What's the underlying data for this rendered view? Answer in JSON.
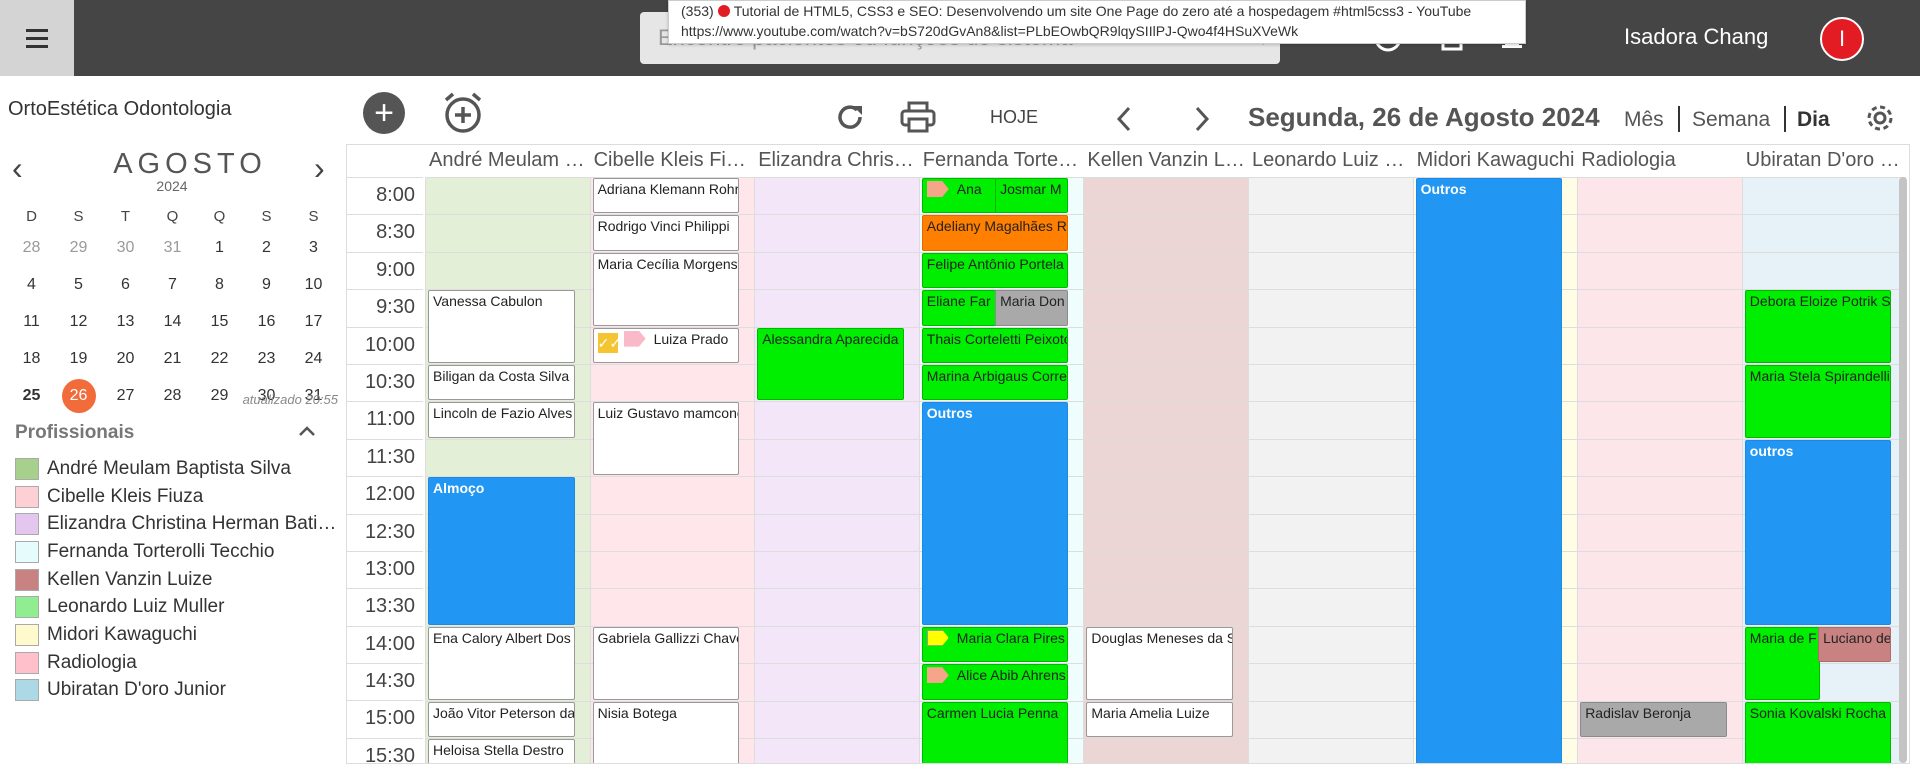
{
  "header": {
    "search_placeholder": "Encontre pacientes ou funções do sistema",
    "user_name": "Isadora Chang",
    "avatar_letter": "I"
  },
  "tooltip": {
    "line1_prefix": "(353)",
    "line1_title": "Tutorial de HTML5, CSS3 e SEO: Desenvolvendo um site One Page do zero até a hospedagem #html5css3 - YouTube",
    "line2": "https://www.youtube.com/watch?v=bS720dGvAn8&list=PLbEOwbQR9lqySIIlPJ-Qwo4f4HSuXVeWk"
  },
  "sidebar": {
    "clinic_name": "OrtoEstética Odontologia",
    "calendar": {
      "month": "AGOSTO",
      "year": "2024",
      "dow": [
        "D",
        "S",
        "T",
        "Q",
        "Q",
        "S",
        "S"
      ],
      "weeks": [
        [
          "28",
          "29",
          "30",
          "31",
          "1",
          "2",
          "3"
        ],
        [
          "4",
          "5",
          "6",
          "7",
          "8",
          "9",
          "10"
        ],
        [
          "11",
          "12",
          "13",
          "14",
          "15",
          "16",
          "17"
        ],
        [
          "18",
          "19",
          "20",
          "21",
          "22",
          "23",
          "24"
        ],
        [
          "25",
          "26",
          "27",
          "28",
          "29",
          "30",
          "31"
        ]
      ],
      "selected": "26",
      "updated": "atualizado 20:55"
    },
    "professionals_title": "Profissionais",
    "professionals": [
      {
        "name": "André Meulam Baptista Silva",
        "color": "#a8d08d"
      },
      {
        "name": "Cibelle Kleis Fiuza",
        "color": "#ffcfd6"
      },
      {
        "name": "Elizandra Christina Herman Batista",
        "color": "#e3c7ef"
      },
      {
        "name": "Fernanda Torterolli Tecchio",
        "color": "#e6fbfb"
      },
      {
        "name": "Kellen Vanzin Luize",
        "color": "#c98282"
      },
      {
        "name": "Leonardo Luiz Muller",
        "color": "#90ee90"
      },
      {
        "name": "Midori Kawaguchi",
        "color": "#fffacd"
      },
      {
        "name": "Radiologia",
        "color": "#ffc0cb"
      },
      {
        "name": "Ubiratan D'oro Junior",
        "color": "#add8e6"
      }
    ]
  },
  "toolbar": {
    "today": "HOJE",
    "date_title": "Segunda, 26 de Agosto 2024",
    "view_month": "Mês",
    "view_week": "Semana",
    "view_day": "Dia"
  },
  "schedule": {
    "times": [
      "8:00",
      "8:30",
      "9:00",
      "9:30",
      "10:00",
      "10:30",
      "11:00",
      "11:30",
      "12:00",
      "12:30",
      "13:00",
      "13:30",
      "14:00",
      "14:30",
      "15:00",
      "15:30"
    ],
    "columns": [
      {
        "name": "André Meulam Baptista Silva",
        "bg": "#e3efd6"
      },
      {
        "name": "Cibelle Kleis Fiuza",
        "bg": "#ffe6ea"
      },
      {
        "name": "Elizandra Christina Herman Batista",
        "bg": "#f3e6f8"
      },
      {
        "name": "Fernanda Torterolli Tecchio",
        "bg": "#f0fdfd"
      },
      {
        "name": "Kellen Vanzin Luize",
        "bg": "#ebd5d5"
      },
      {
        "name": "Leonardo Luiz Muller",
        "bg": "#f2f2f2"
      },
      {
        "name": "Midori Kawaguchi",
        "bg": "#fffde6"
      },
      {
        "name": "Radiologia",
        "bg": "#fde6ea"
      },
      {
        "name": "Ubiratan D'oro Junior",
        "bg": "#e6f2f7"
      }
    ],
    "events": [
      {
        "col": 0,
        "start": 3,
        "span": 2,
        "style": "white",
        "text": "Vanessa Cabulon"
      },
      {
        "col": 0,
        "start": 5,
        "span": 1,
        "style": "white",
        "text": "Biligan da Costa Silva"
      },
      {
        "col": 0,
        "start": 6,
        "span": 1,
        "style": "white",
        "text": "Lincoln de Fazio Alves"
      },
      {
        "col": 0,
        "start": 8,
        "span": 4,
        "style": "blue",
        "text": "Almoço"
      },
      {
        "col": 0,
        "start": 12,
        "span": 2,
        "style": "white",
        "text": "Ena Calory Albert Dos Santos"
      },
      {
        "col": 0,
        "start": 14,
        "span": 1,
        "style": "white",
        "text": "João Vitor Peterson da Silva"
      },
      {
        "col": 0,
        "start": 15,
        "span": 1,
        "style": "white",
        "text": "Heloisa Stella Destro"
      },
      {
        "col": 1,
        "start": 0,
        "span": 1,
        "style": "white",
        "text": "Adriana Klemann Rohr"
      },
      {
        "col": 1,
        "start": 1,
        "span": 1,
        "style": "white",
        "text": "Rodrigo Vinci Philippi"
      },
      {
        "col": 1,
        "start": 2,
        "span": 2,
        "style": "white",
        "text": "Maria Cecília Morgenstern"
      },
      {
        "col": 1,
        "start": 4,
        "span": 1,
        "style": "white",
        "text": "Luiza Prado",
        "check": true,
        "tag": "pink"
      },
      {
        "col": 1,
        "start": 6,
        "span": 2,
        "style": "white",
        "text": "Luiz Gustavo mamcono"
      },
      {
        "col": 1,
        "start": 12,
        "span": 2,
        "style": "white",
        "text": "Gabriela Gallizzi Chaves"
      },
      {
        "col": 1,
        "start": 14,
        "span": 2,
        "style": "white",
        "text": "Nisia Botega"
      },
      {
        "col": 2,
        "start": 4,
        "span": 2,
        "style": "green",
        "text": "Alessandra Aparecida"
      },
      {
        "col": 3,
        "start": 0,
        "span": 1,
        "style": "green",
        "text": "Ana",
        "tag": "salmon",
        "half": "left"
      },
      {
        "col": 3,
        "start": 0,
        "span": 1,
        "style": "green",
        "text": "Josmar M",
        "half": "right"
      },
      {
        "col": 3,
        "start": 1,
        "span": 1,
        "style": "orange",
        "text": "Adeliany Magalhães Ramos"
      },
      {
        "col": 3,
        "start": 2,
        "span": 1,
        "style": "green",
        "text": "Felipe Antônio Portela"
      },
      {
        "col": 3,
        "start": 3,
        "span": 1,
        "style": "green",
        "text": "Eliane Far",
        "half": "left"
      },
      {
        "col": 3,
        "start": 3,
        "span": 1,
        "style": "gray",
        "text": "Maria Don",
        "half": "right"
      },
      {
        "col": 3,
        "start": 4,
        "span": 1,
        "style": "green",
        "text": "Thais Corteletti Peixoto"
      },
      {
        "col": 3,
        "start": 5,
        "span": 1,
        "style": "green",
        "text": "Marina Arbigaus Correa"
      },
      {
        "col": 3,
        "start": 6,
        "span": 6,
        "style": "blue",
        "text": "Outros"
      },
      {
        "col": 3,
        "start": 12,
        "span": 1,
        "style": "green",
        "text": "Maria Clara Pires",
        "tag": "yellow"
      },
      {
        "col": 3,
        "start": 13,
        "span": 1,
        "style": "green",
        "text": "Alice Abib Ahrens",
        "tag": "salmon"
      },
      {
        "col": 3,
        "start": 14,
        "span": 2,
        "style": "green",
        "text": "Carmen Lucia Penna"
      },
      {
        "col": 4,
        "start": 12,
        "span": 2,
        "style": "white",
        "text": "Douglas Meneses da Silva"
      },
      {
        "col": 4,
        "start": 14,
        "span": 1,
        "style": "white",
        "text": "Maria Amelia Luize"
      },
      {
        "col": 6,
        "start": 0,
        "span": 16,
        "style": "blue",
        "text": "Outros"
      },
      {
        "col": 7,
        "start": 14,
        "span": 1,
        "style": "gray",
        "text": "Radislav Beronja"
      },
      {
        "col": 8,
        "start": 3,
        "span": 2,
        "style": "green",
        "text": "Debora Eloize Potrik Silva"
      },
      {
        "col": 8,
        "start": 5,
        "span": 2,
        "style": "green",
        "text": "Maria Stela Spirandelli"
      },
      {
        "col": 8,
        "start": 7,
        "span": 5,
        "style": "blue",
        "text": "outros"
      },
      {
        "col": 8,
        "start": 12,
        "span": 2,
        "style": "green",
        "text": "Maria de F",
        "half": "left"
      },
      {
        "col": 8,
        "start": 12,
        "span": 1,
        "style": "rose",
        "text": "Luciano de",
        "half": "right"
      },
      {
        "col": 8,
        "start": 14,
        "span": 2,
        "style": "green",
        "text": "Sonia Kovalski Rocha"
      }
    ]
  }
}
